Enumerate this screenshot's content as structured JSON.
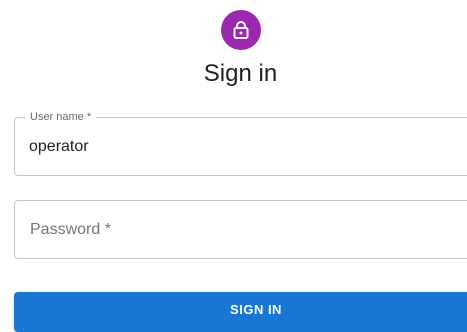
{
  "header": {
    "icon": "lock-icon",
    "title": "Sign in"
  },
  "form": {
    "username": {
      "label": "User name *",
      "value": "operator"
    },
    "password": {
      "label": "Password *",
      "value": ""
    },
    "submit_label": "SIGN IN"
  },
  "colors": {
    "avatar": "#9c27b0",
    "primary": "#1976d2"
  }
}
